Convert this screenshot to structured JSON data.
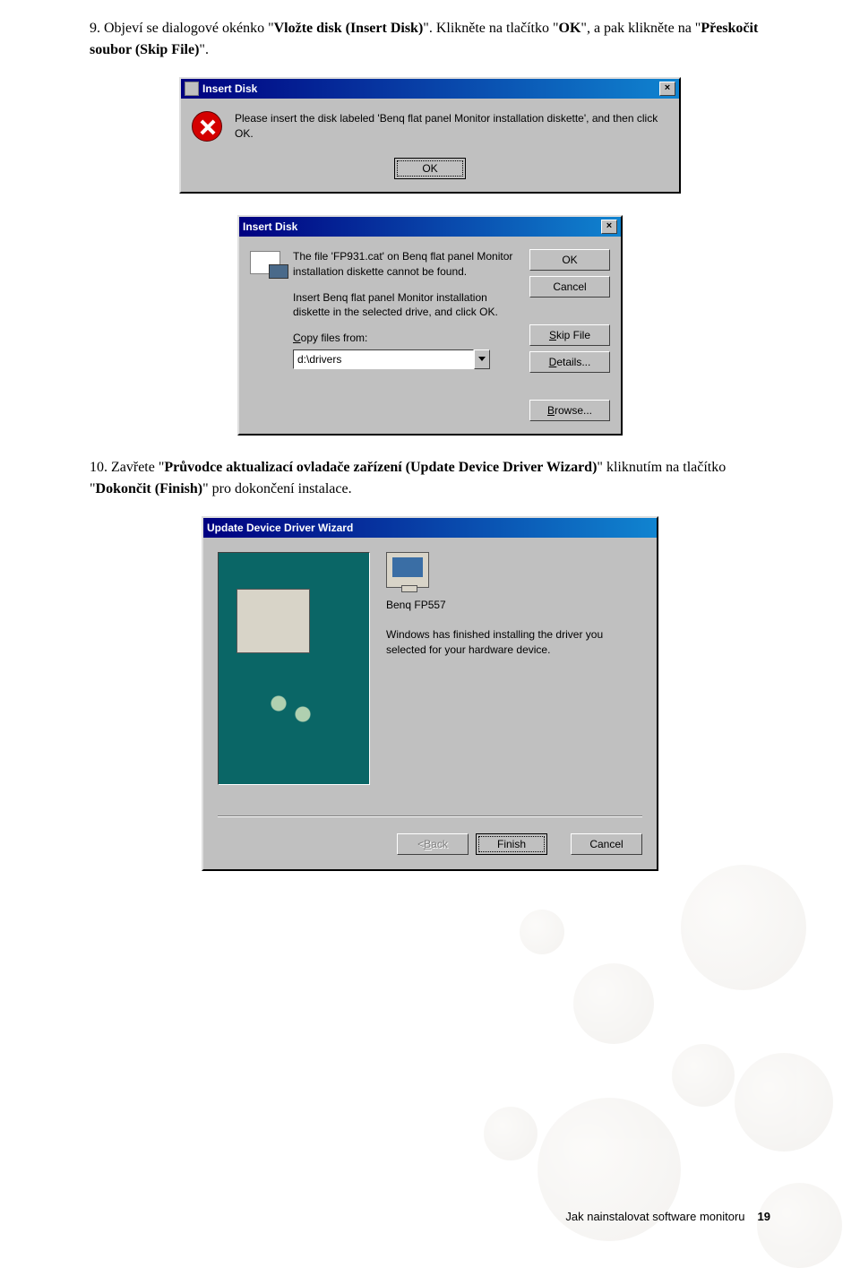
{
  "step9": {
    "number": "9.",
    "text_before_bold1": "Objeví se dialogové okénko \"",
    "bold1": "Vložte disk (Insert Disk)",
    "text_mid1": "\". Klikněte na tlačítko \"",
    "bold2": "OK",
    "text_mid2": "\", a pak klikněte na \"",
    "bold3": "Přeskočit soubor (Skip File)",
    "text_end": "\"."
  },
  "dialog1": {
    "title": "Insert Disk",
    "message": "Please insert the disk labeled 'Benq flat panel Monitor installation diskette', and then click OK.",
    "ok": "OK"
  },
  "dialog2": {
    "title": "Insert Disk",
    "line1": "The file 'FP931.cat' on Benq flat panel Monitor installation diskette cannot be found.",
    "line2": "Insert Benq flat panel Monitor installation diskette in the selected drive, and click OK.",
    "copy_label": "Copy files from:",
    "path": "d:\\drivers",
    "buttons": {
      "ok": "OK",
      "cancel": "Cancel",
      "skip": "Skip File",
      "details": "Details...",
      "browse": "Browse..."
    }
  },
  "step10": {
    "number": "10.",
    "text_before_bold1": "Zavřete \"",
    "bold1": "Průvodce aktualizací ovladače zařízení (Update Device Driver Wizard)",
    "text_mid1": "\" kliknutím na tlačítko \"",
    "bold2": "Dokončit (Finish)",
    "text_end": "\" pro dokončení instalace."
  },
  "wizard": {
    "title": "Update Device Driver Wizard",
    "device": "Benq FP557",
    "message": "Windows has finished installing the driver you selected for your hardware device.",
    "back": "< Back",
    "finish": "Finish",
    "cancel": "Cancel"
  },
  "footer": {
    "text": "Jak nainstalovat software monitoru",
    "page": "19"
  }
}
